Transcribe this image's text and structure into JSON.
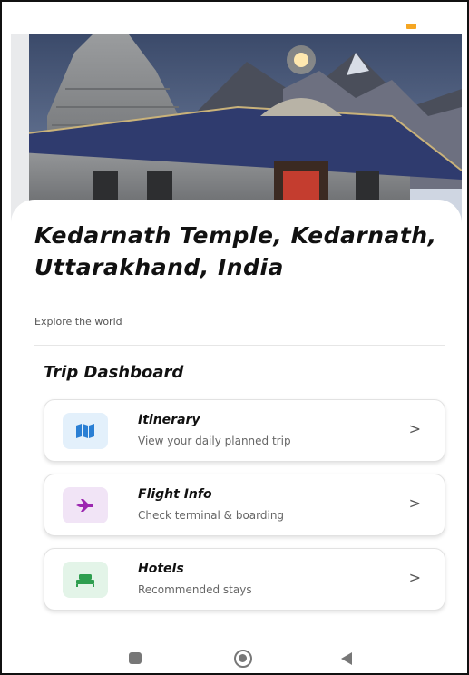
{
  "destination": {
    "title": "Kedarnath Temple, Kedarnath, Uttarakhand, India",
    "subtitle": "Explore the world"
  },
  "dashboard": {
    "heading": "Trip Dashboard",
    "cards": [
      {
        "title": "Itinerary",
        "subtitle": "View your daily planned trip",
        "icon": "map-icon",
        "chevron": ">"
      },
      {
        "title": "Flight Info",
        "subtitle": "Check terminal & boarding",
        "icon": "airplane-icon",
        "chevron": ">"
      },
      {
        "title": "Hotels",
        "subtitle": "Recommended stays",
        "icon": "bed-icon",
        "chevron": ">"
      }
    ]
  },
  "colors": {
    "itinerary_accent": "#2a7fd4",
    "flight_accent": "#9c27b0",
    "hotels_accent": "#2e9e4f",
    "status_battery": "#f5a623"
  }
}
